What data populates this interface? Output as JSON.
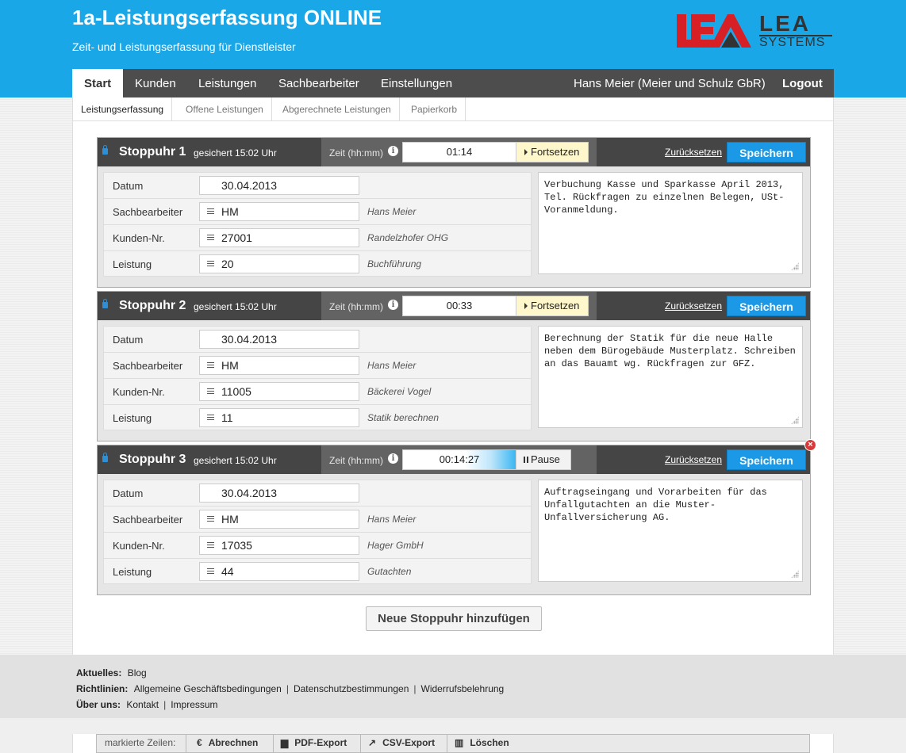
{
  "header": {
    "title": "1a-Leistungserfassung ONLINE",
    "subtitle": "Zeit- und Leistungserfassung für Dienstleister",
    "logo": {
      "text": "LEA",
      "sub": "SYSTEMS",
      "colors": {
        "red": "#d71f26",
        "dark": "#333333"
      }
    }
  },
  "nav": {
    "tabs": [
      "Start",
      "Kunden",
      "Leistungen",
      "Sachbearbeiter",
      "Einstellungen"
    ],
    "user": "Hans Meier (Meier und Schulz GbR)",
    "logout": "Logout"
  },
  "subnav": [
    "Leistungserfassung",
    "Offene Leistungen",
    "Abgerechnete Leistungen",
    "Papierkorb"
  ],
  "common": {
    "saved_text": "gesichert 15:02 Uhr",
    "time_label": "Zeit (hh:mm)",
    "continue_label": "Fortsetzen",
    "pause_label": "Pause",
    "reset_label": "Zurücksetzen",
    "save_label": "Speichern",
    "field_labels": {
      "date": "Datum",
      "staff": "Sachbearbeiter",
      "customer": "Kunden-Nr.",
      "service": "Leistung"
    }
  },
  "stopwatches": [
    {
      "title": "Stoppuhr 1",
      "time": "01:14",
      "running": false,
      "date": "30.04.2013",
      "staff": {
        "code": "HM",
        "name": "Hans Meier"
      },
      "customer": {
        "code": "27001",
        "name": "Randelzhofer OHG"
      },
      "service": {
        "code": "20",
        "name": "Buchführung"
      },
      "note": "Verbuchung Kasse und Sparkasse April 2013, Tel. Rückfragen zu einzelnen Belegen, USt-Voranmeldung."
    },
    {
      "title": "Stoppuhr 2",
      "time": "00:33",
      "running": false,
      "date": "30.04.2013",
      "staff": {
        "code": "HM",
        "name": "Hans Meier"
      },
      "customer": {
        "code": "11005",
        "name": "Bäckerei Vogel"
      },
      "service": {
        "code": "11",
        "name": "Statik berechnen"
      },
      "note": "Berechnung der Statik für die neue Halle neben dem Bürogebäude Musterplatz. Schreiben an das Bauamt wg. Rückfragen zur GFZ."
    },
    {
      "title": "Stoppuhr 3",
      "time": "00:14:27",
      "running": true,
      "date": "30.04.2013",
      "staff": {
        "code": "HM",
        "name": "Hans Meier"
      },
      "customer": {
        "code": "17035",
        "name": "Hager GmbH"
      },
      "service": {
        "code": "44",
        "name": "Gutachten"
      },
      "note": "Auftragseingang und Vorarbeiten für das Unfallgutachten an die Muster-Unfallversicherung AG."
    }
  ],
  "add_button": "Neue Stoppuhr hinzufügen",
  "footer": {
    "news_label": "Aktuelles:",
    "news": [
      "Blog"
    ],
    "policies_label": "Richtlinien:",
    "policies": [
      "Allgemeine Geschäftsbedingungen",
      "Datenschutzbestimmungen",
      "Widerrufsbelehrung"
    ],
    "about_label": "Über uns:",
    "about": [
      "Kontakt",
      "Impressum"
    ]
  },
  "toolbar": {
    "label": "markierte Zeilen:",
    "actions": [
      {
        "icon": "euro-icon",
        "glyph": "€",
        "label": "Abrechnen"
      },
      {
        "icon": "printer-icon",
        "glyph": "▆",
        "label": "PDF-Export"
      },
      {
        "icon": "export-icon",
        "glyph": "↗",
        "label": "CSV-Export"
      },
      {
        "icon": "trash-icon",
        "glyph": "▥",
        "label": "Löschen"
      }
    ]
  }
}
